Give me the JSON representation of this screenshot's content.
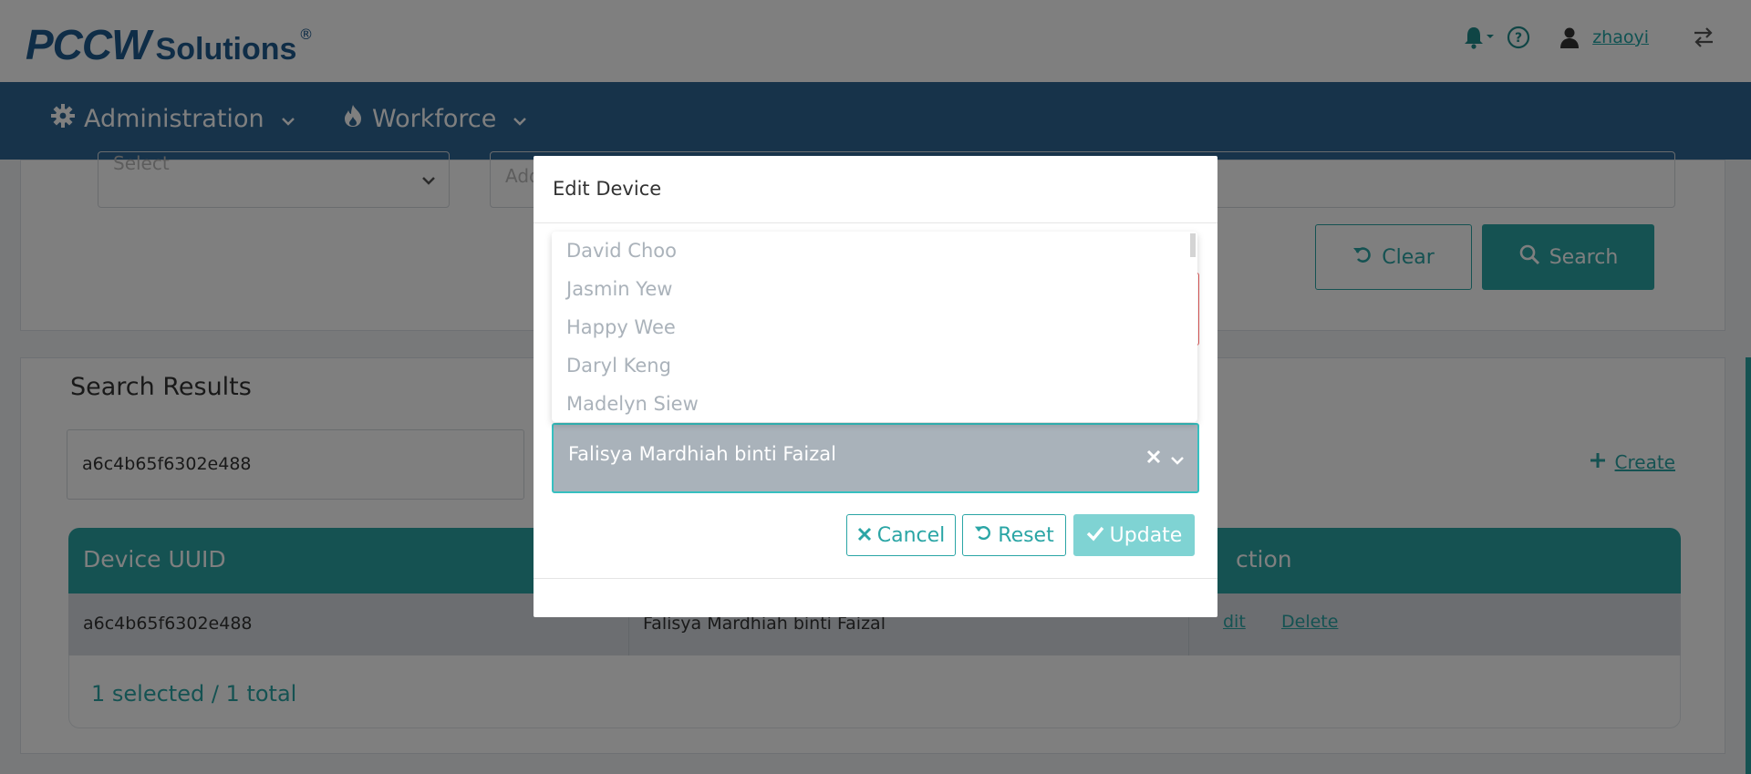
{
  "header": {
    "logo_brand": "PCCW",
    "logo_suffix": "Solutions",
    "logo_reg": "®",
    "username": "zhaoyi"
  },
  "nav": {
    "items": [
      {
        "label": "Administration",
        "icon": "gear-icon"
      },
      {
        "label": "Workforce",
        "icon": "fire-icon"
      }
    ]
  },
  "filters": {
    "select_placeholder": "Select",
    "input2_placeholder": "Add",
    "clear_label": "Clear",
    "search_label": "Search"
  },
  "results": {
    "title": "Search Results",
    "search_value": "a6c4b65f6302e488",
    "create_label": "Create",
    "columns": [
      "Device UUID",
      "",
      "ction"
    ],
    "rows": [
      {
        "uuid": "a6c4b65f6302e488",
        "name": "Falisya Mardhiah binti Faizal",
        "edit": "dit",
        "delete": "Delete"
      }
    ],
    "footer": "1 selected / 1 total"
  },
  "modal": {
    "title": "Edit Device",
    "dropdown_options": [
      "David Choo",
      "Jasmin Yew",
      "Happy Wee",
      "Daryl Keng",
      "Madelyn Siew"
    ],
    "selected_value": "Falisya Mardhiah binti Faizal",
    "cancel_label": "Cancel",
    "reset_label": "Reset",
    "update_label": "Update"
  },
  "colors": {
    "brand": "#1f5a8e",
    "nav": "#2e6695",
    "accent": "#2aa5a5",
    "overlay": "rgba(0,0,0,0.5)"
  }
}
